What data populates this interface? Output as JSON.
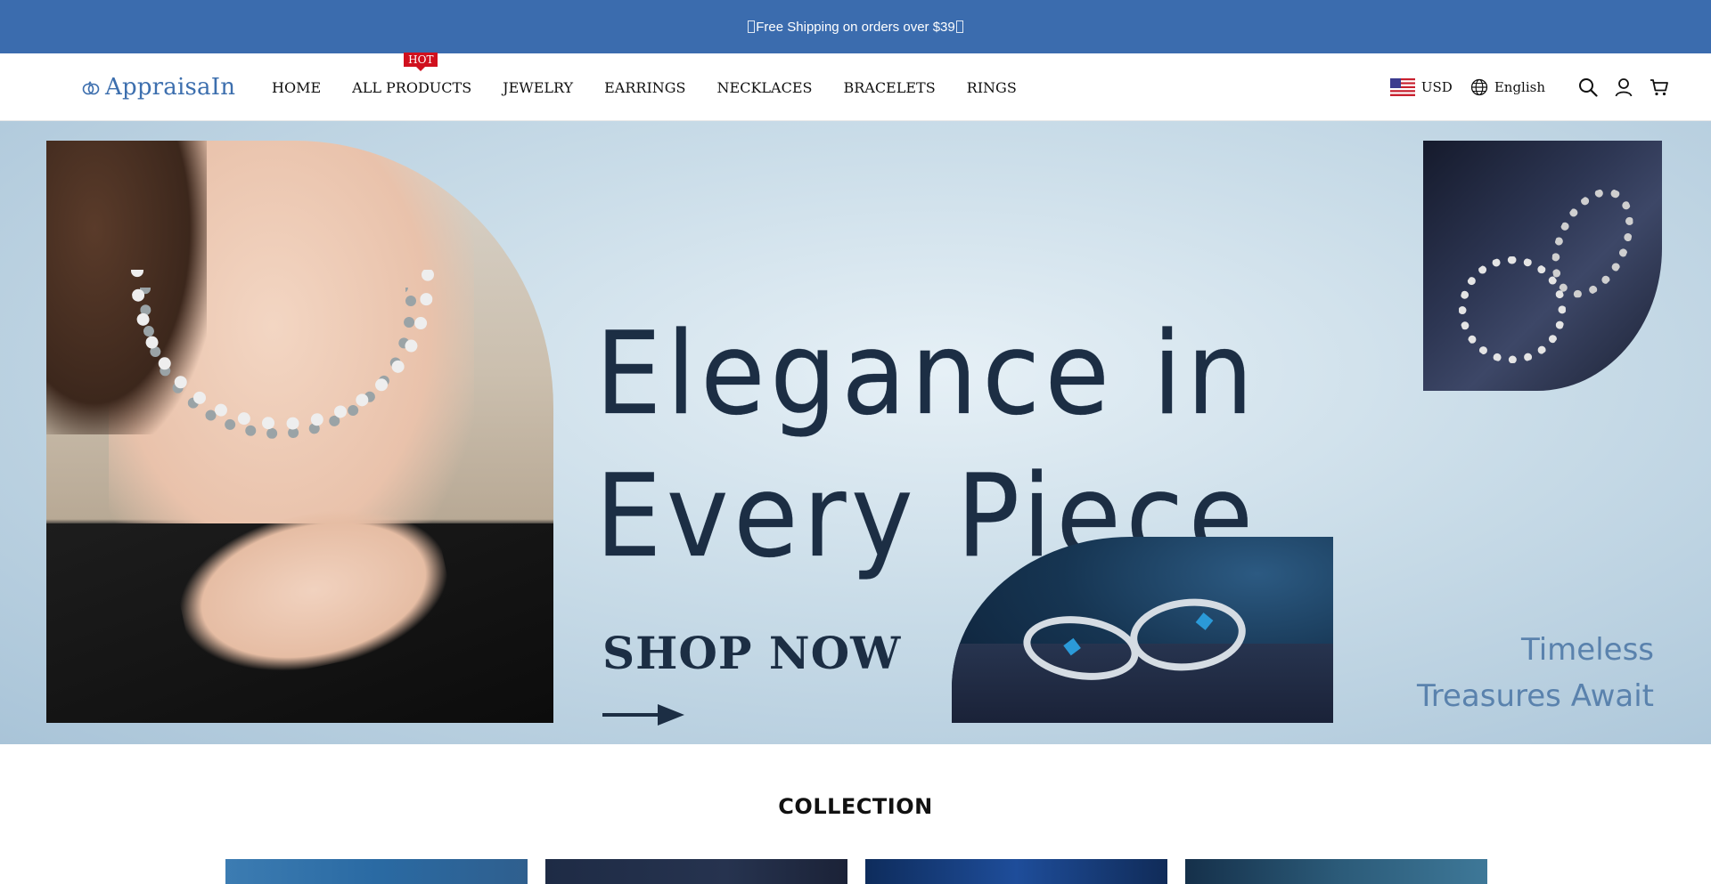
{
  "announcement": {
    "text": "Free Shipping on orders over $39"
  },
  "header": {
    "logo_text": "AppraisaIn",
    "nav": [
      {
        "label": "HOME"
      },
      {
        "label": "ALL PRODUCTS",
        "badge": "HOT"
      },
      {
        "label": "JEWELRY"
      },
      {
        "label": "EARRINGS"
      },
      {
        "label": "NECKLACES"
      },
      {
        "label": "BRACELETS"
      },
      {
        "label": "RINGS"
      }
    ],
    "currency": "USD",
    "language": "English",
    "icons": [
      "search-icon",
      "account-icon",
      "cart-icon"
    ]
  },
  "hero": {
    "title_line1": "Elegance in",
    "title_line2": "Every Piece",
    "cta": "SHOP NOW",
    "tagline_line1": "Timeless",
    "tagline_line2": "Treasures Await"
  },
  "collection": {
    "title": "COLLECTION"
  },
  "colors": {
    "announcement_bg": "#3b6cae",
    "logo": "#3d6fae",
    "hot_badge": "#d0101e",
    "hero_text": "#1c2e44",
    "tagline": "#5a82ad"
  }
}
